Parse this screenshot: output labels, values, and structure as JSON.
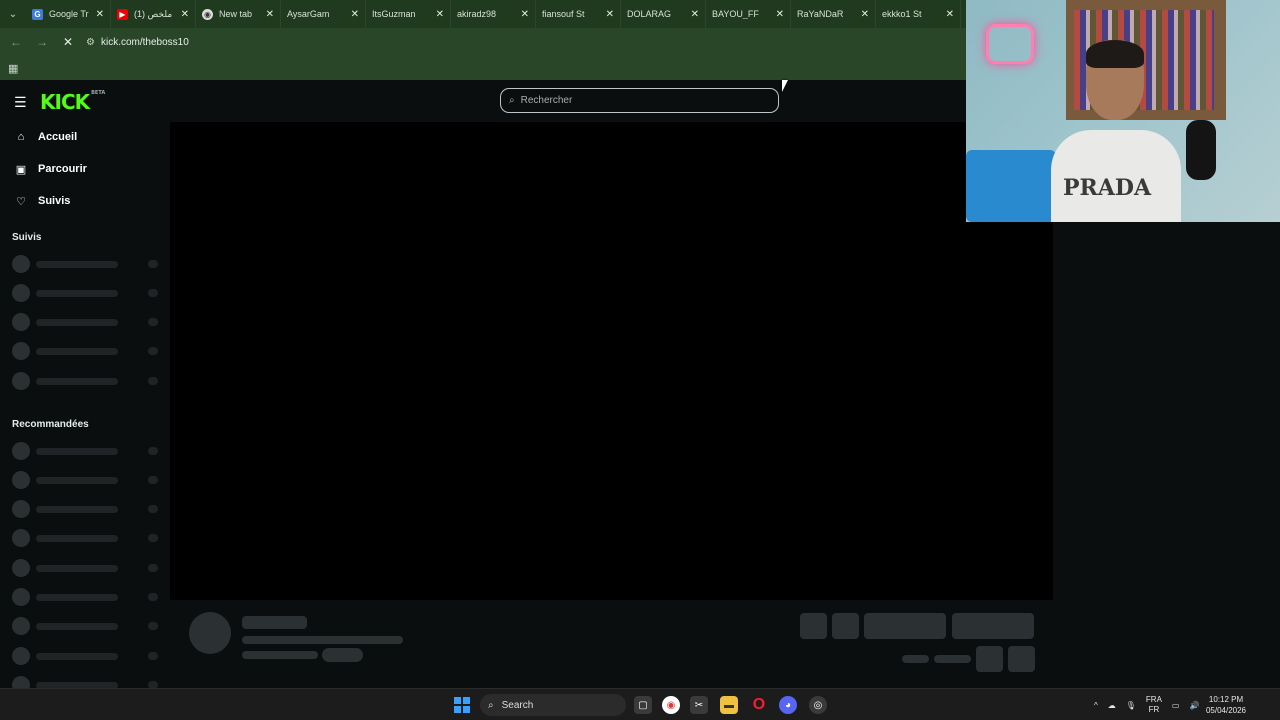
{
  "browser": {
    "tabs": [
      {
        "icon": "google-icon",
        "label": "Google Tr"
      },
      {
        "icon": "youtube-icon",
        "label": "ملخص (1)"
      },
      {
        "icon": "chrome-icon",
        "label": "New tab"
      },
      {
        "icon": "kick-icon",
        "label": "AysarGam"
      },
      {
        "icon": "kick-icon",
        "label": "ItsGuzman"
      },
      {
        "icon": "kick-icon",
        "label": "akiradz98"
      },
      {
        "icon": "kick-icon",
        "label": "fiansouf St"
      },
      {
        "icon": "kick-icon",
        "label": "DOLARAG"
      },
      {
        "icon": "kick-icon",
        "label": "BAYOU_FF"
      },
      {
        "icon": "kick-icon",
        "label": "RaYaNDaR"
      },
      {
        "icon": "kick-icon",
        "label": "ekkko1 St"
      }
    ],
    "url": "kick.com/theboss10"
  },
  "kick": {
    "logo": "KICK",
    "logo_badge": "BETA",
    "search_placeholder": "Rechercher",
    "nav": {
      "home": "Accueil",
      "browse": "Parcourir",
      "following": "Suivis"
    },
    "sections": {
      "following": "Suivis",
      "recommended": "Recommandées"
    },
    "colors": {
      "accent": "#53fc18",
      "background": "#0b0e0f",
      "skeleton": "#2b3032"
    }
  },
  "webcam": {
    "shirt_text": "PRADA"
  },
  "taskbar": {
    "search_label": "Search",
    "language": "FRA",
    "language_sub": "FR",
    "time": "10:12 PM",
    "date": "05/04/2026"
  }
}
